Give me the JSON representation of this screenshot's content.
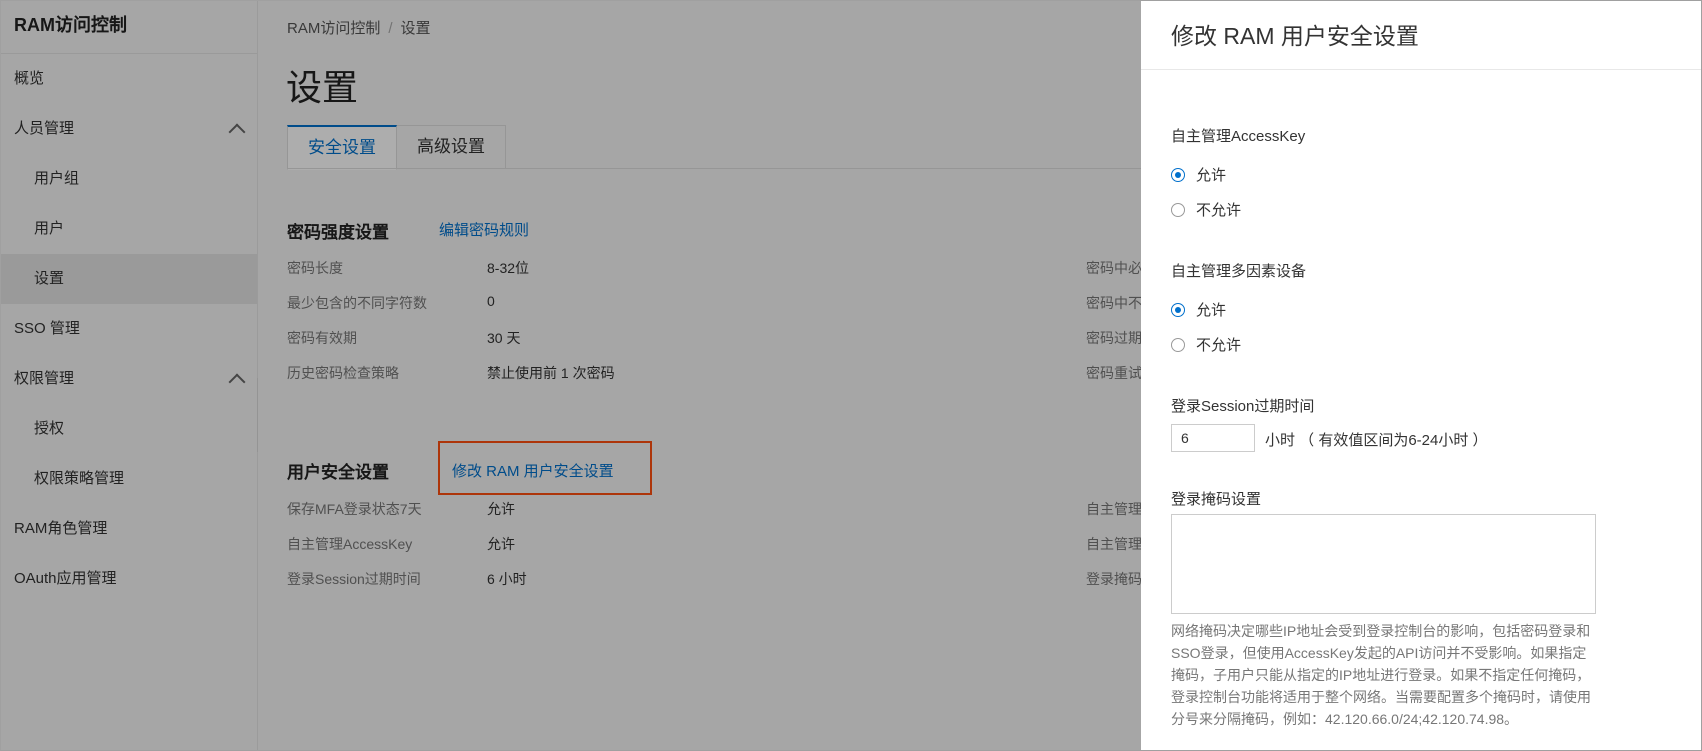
{
  "sidebar": {
    "title": "RAM访问控制",
    "items": [
      {
        "label": "概览"
      },
      {
        "label": "人员管理"
      },
      {
        "label": "用户组"
      },
      {
        "label": "用户"
      },
      {
        "label": "设置"
      },
      {
        "label": "SSO 管理"
      },
      {
        "label": "权限管理"
      },
      {
        "label": "授权"
      },
      {
        "label": "权限策略管理"
      },
      {
        "label": "RAM角色管理"
      },
      {
        "label": "OAuth应用管理"
      }
    ]
  },
  "breadcrumb": {
    "root": "RAM访问控制",
    "sep": "/",
    "current": "设置"
  },
  "page_title": "设置",
  "tabs": [
    {
      "label": "安全设置"
    },
    {
      "label": "高级设置"
    }
  ],
  "password_section": {
    "title": "密码强度设置",
    "link": "编辑密码规则",
    "rows": [
      {
        "label": "密码长度",
        "value": "8-32位"
      },
      {
        "label": "最少包含的不同字符数",
        "value": "0"
      },
      {
        "label": "密码有效期",
        "value": "30 天"
      },
      {
        "label": "历史密码检查策略",
        "value": "禁止使用前 1 次密码"
      }
    ],
    "right_labels": [
      "密码中必",
      "密码中不",
      "密码过期",
      "密码重试"
    ]
  },
  "user_security_section": {
    "title": "用户安全设置",
    "link": "修改 RAM 用户安全设置",
    "rows": [
      {
        "label": "保存MFA登录状态7天",
        "value": "允许"
      },
      {
        "label": "自主管理AccessKey",
        "value": "允许"
      },
      {
        "label": "登录Session过期时间",
        "value": "6 小时"
      }
    ],
    "right_labels": [
      "自主管理",
      "自主管理",
      "登录掩码"
    ]
  },
  "drawer": {
    "title": "修改 RAM 用户安全设置",
    "accesskey": {
      "label": "自主管理AccessKey",
      "options": [
        "允许",
        "不允许"
      ],
      "selected": "允许"
    },
    "mfa": {
      "label": "自主管理多因素设备",
      "options": [
        "允许",
        "不允许"
      ],
      "selected": "允许"
    },
    "session": {
      "label": "登录Session过期时间",
      "value": "6",
      "hint": "小时 （ 有效值区间为6-24小时 ）"
    },
    "mask": {
      "label": "登录掩码设置",
      "value": "",
      "description": "网络掩码决定哪些IP地址会受到登录控制台的影响，包括密码登录和SSO登录，但使用AccessKey发起的API访问并不受影响。如果指定掩码，子用户只能从指定的IP地址进行登录。如果不指定任何掩码，登录控制台功能将适用于整个网络。当需要配置多个掩码时，请使用分号来分隔掩码，例如：42.120.66.0/24;42.120.74.98。"
    }
  },
  "colors": {
    "accent": "#0070cc",
    "highlight": "#ff4e0f"
  }
}
